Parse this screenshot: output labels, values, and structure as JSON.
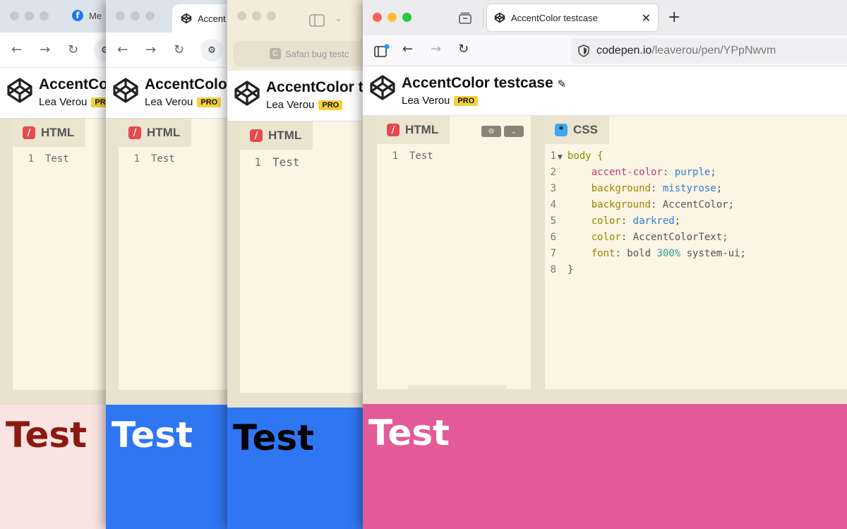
{
  "pen": {
    "title": "AccentColor testcase",
    "author": "Lea Verou",
    "pro": "PRO"
  },
  "chrome1": {
    "tab": "Me",
    "html_tab": "HTML",
    "html_code": "Test",
    "preview": "Test"
  },
  "chrome2": {
    "tab": "Accent",
    "title": "AccentColor",
    "html_tab": "HTML",
    "html_code": "Test",
    "preview": "Test"
  },
  "safari": {
    "url": "Safari bug testc",
    "title": "AccentColor te",
    "favicon": "C",
    "html_tab": "HTML",
    "html_code": "Test",
    "preview": "Test"
  },
  "firefox": {
    "tab_title": "AccentColor testcase",
    "url_host": "codepen.io",
    "url_path": "/leaverou/pen/YPpNwvm",
    "html_tab": "HTML",
    "css_tab": "CSS",
    "html_code": "Test",
    "preview": "Test",
    "css_lines": {
      "l1_sel": "body",
      "l1_brace": "{",
      "l2_prop": "accent-color",
      "l2_val": "purple",
      "l3_prop": "background",
      "l3_val": "mistyrose",
      "l4_prop": "background",
      "l4_val": "AccentColor",
      "l5_prop": "color",
      "l5_val": "darkred",
      "l6_prop": "color",
      "l6_val": "AccentColorText",
      "l7_prop": "font",
      "l7_val_a": "bold",
      "l7_val_b": "300%",
      "l7_val_c": "system-ui",
      "l8": "}"
    }
  },
  "line_numbers": [
    "1",
    "2",
    "3",
    "4",
    "5",
    "6",
    "7",
    "8"
  ],
  "colors": {
    "preview_chrome1_bg": "#fae4e2",
    "preview_chrome1_fg": "#8b1a10",
    "preview_chrome2_bg": "#2f76f2",
    "preview_chrome2_fg": "#ffffff",
    "preview_safari_bg": "#2f76f2",
    "preview_safari_fg": "#000000",
    "preview_firefox_bg": "#e35a9a",
    "preview_firefox_fg": "#ffffff"
  }
}
